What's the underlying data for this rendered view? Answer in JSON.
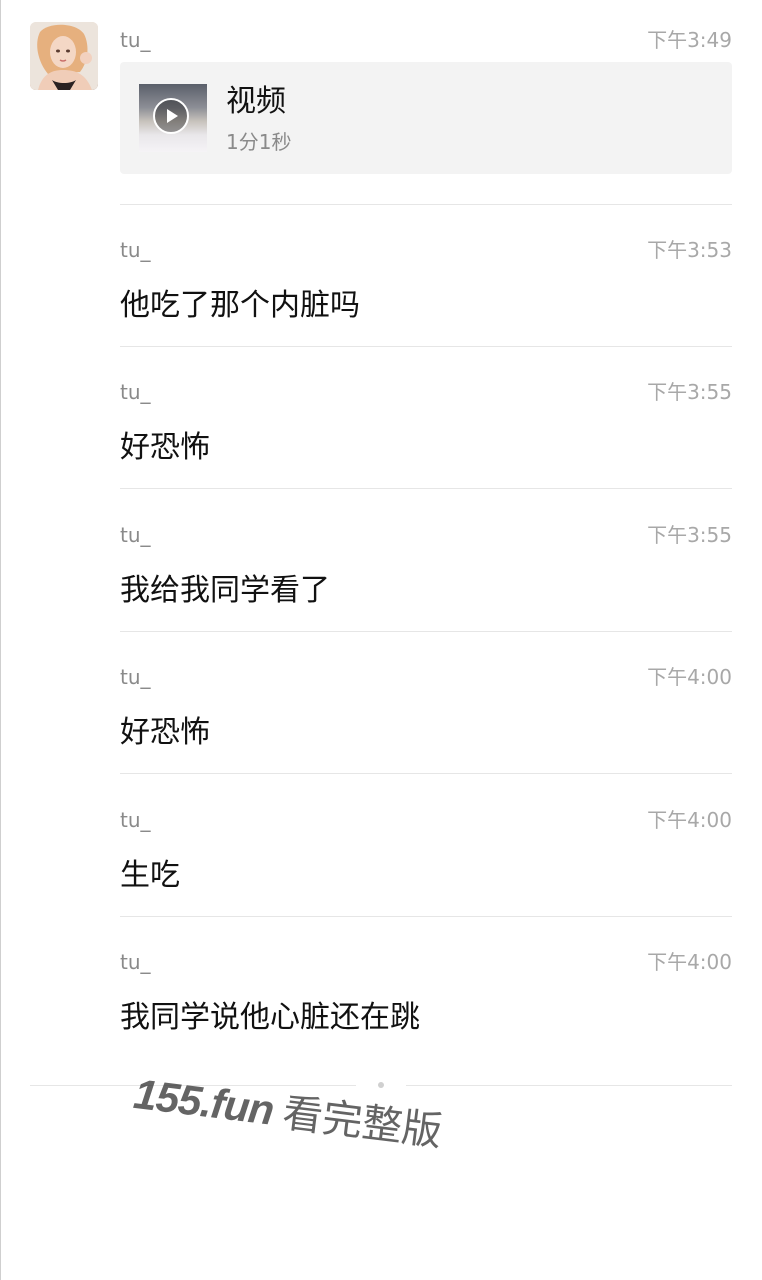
{
  "messages": [
    {
      "sender": "tu_",
      "time": "下午3:49",
      "type": "video",
      "video": {
        "label": "视频",
        "duration": "1分1秒"
      }
    },
    {
      "sender": "tu_",
      "time": "下午3:53",
      "type": "text",
      "text": "他吃了那个内脏吗"
    },
    {
      "sender": "tu_",
      "time": "下午3:55",
      "type": "text",
      "text": "好恐怖"
    },
    {
      "sender": "tu_",
      "time": "下午3:55",
      "type": "text",
      "text": "我给我同学看了"
    },
    {
      "sender": "tu_",
      "time": "下午4:00",
      "type": "text",
      "text": "好恐怖"
    },
    {
      "sender": "tu_",
      "time": "下午4:00",
      "type": "text",
      "text": "生吃"
    },
    {
      "sender": "tu_",
      "time": "下午4:00",
      "type": "text",
      "text": "我同学说他心脏还在跳"
    }
  ],
  "watermark": {
    "domain": "155.fun",
    "tail": "看完整版"
  },
  "colors": {
    "background": "#ffffff",
    "card": "#f3f3f3",
    "divider": "#e6e6e6",
    "muted": "#8a8a8a",
    "time": "#a8a8a8"
  }
}
